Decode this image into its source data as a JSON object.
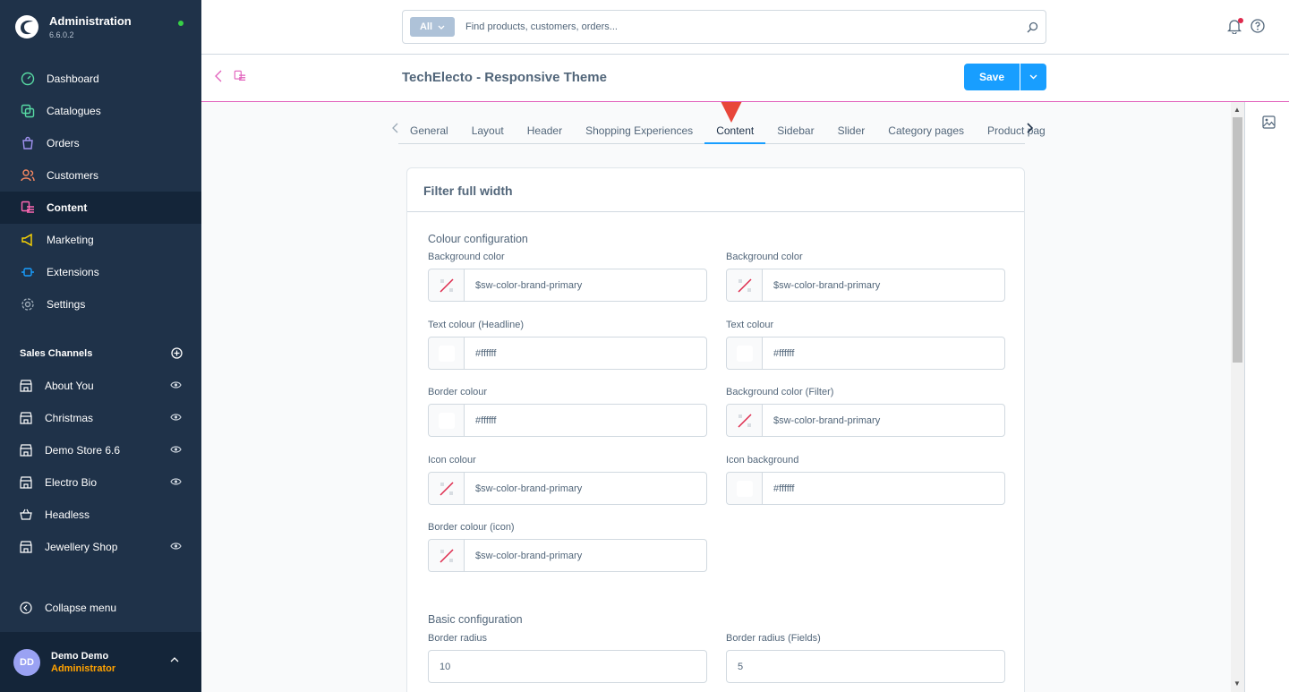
{
  "sidebar": {
    "brand_title": "Administration",
    "brand_version": "6.6.0.2",
    "nav": [
      {
        "label": "Dashboard",
        "icon": "dashboard-icon",
        "color": "#57d9a3"
      },
      {
        "label": "Catalogues",
        "icon": "catalogue-icon",
        "color": "#57d9a3"
      },
      {
        "label": "Orders",
        "icon": "orders-icon",
        "color": "#a092f0"
      },
      {
        "label": "Customers",
        "icon": "customers-icon",
        "color": "#f88962"
      },
      {
        "label": "Content",
        "icon": "content-icon",
        "color": "#ff68b4"
      },
      {
        "label": "Marketing",
        "icon": "marketing-icon",
        "color": "#ffd700"
      },
      {
        "label": "Extensions",
        "icon": "extensions-icon",
        "color": "#189eff"
      },
      {
        "label": "Settings",
        "icon": "settings-icon",
        "color": "#9aa8b5"
      }
    ],
    "sales_channels_title": "Sales Channels",
    "sales_channels": [
      {
        "label": "About You"
      },
      {
        "label": "Christmas"
      },
      {
        "label": "Demo Store 6.6"
      },
      {
        "label": "Electro Bio"
      },
      {
        "label": "Headless"
      },
      {
        "label": "Jewellery Shop"
      }
    ],
    "collapse_label": "Collapse menu",
    "user": {
      "initials": "DD",
      "name": "Demo Demo",
      "role": "Administrator"
    }
  },
  "topbar": {
    "search_type": "All",
    "search_placeholder": "Find products, customers, orders..."
  },
  "smartbar": {
    "title": "TechElecto - Responsive Theme",
    "save_label": "Save"
  },
  "tabs": [
    "General",
    "Layout",
    "Header",
    "Shopping Experiences",
    "Content",
    "Sidebar",
    "Slider",
    "Category pages",
    "Product pag"
  ],
  "active_tab": "Content",
  "card": {
    "title": "Filter full width",
    "colour_section": "Colour configuration",
    "basic_section": "Basic configuration",
    "fields": {
      "bg_color_1": {
        "label": "Background color",
        "value": "$sw-color-brand-primary"
      },
      "bg_color_2": {
        "label": "Background color",
        "value": "$sw-color-brand-primary"
      },
      "text_headline": {
        "label": "Text colour (Headline)",
        "value": "#ffffff"
      },
      "text_colour": {
        "label": "Text colour",
        "value": "#ffffff"
      },
      "border_colour": {
        "label": "Border colour",
        "value": "#ffffff"
      },
      "bg_filter": {
        "label": "Background color (Filter)",
        "value": "$sw-color-brand-primary"
      },
      "icon_colour": {
        "label": "Icon colour",
        "value": "$sw-color-brand-primary"
      },
      "icon_bg": {
        "label": "Icon background",
        "value": "#ffffff"
      },
      "border_icon": {
        "label": "Border colour (icon)",
        "value": "$sw-color-brand-primary"
      },
      "border_radius": {
        "label": "Border radius",
        "value": "10"
      },
      "border_radius_fields": {
        "label": "Border radius (Fields)",
        "value": "5"
      }
    }
  },
  "colors": {
    "primary": "#189eff",
    "sidebar": "#1f3249",
    "accent_line": "#e15fbb",
    "annotation_arrow": "#e8463a"
  }
}
